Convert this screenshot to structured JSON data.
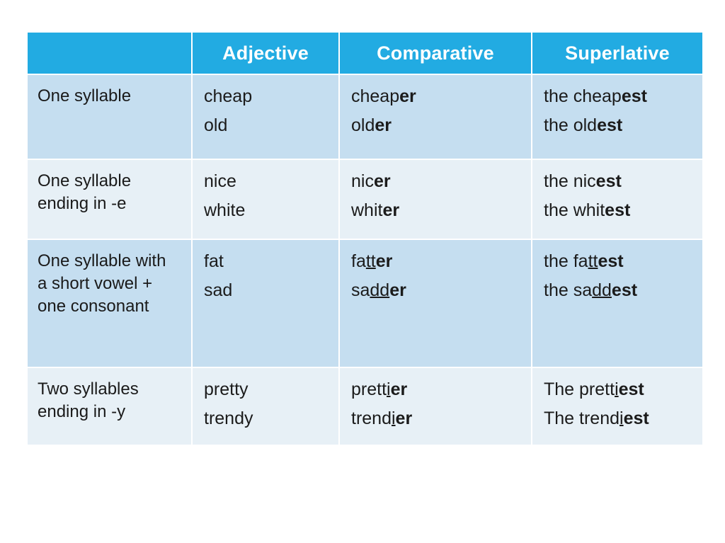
{
  "table": {
    "columns": [
      {
        "key": "rule",
        "label": ""
      },
      {
        "key": "adjective",
        "label": "Adjective"
      },
      {
        "key": "comparative",
        "label": "Comparative"
      },
      {
        "key": "superlative",
        "label": "Superlative"
      }
    ],
    "colors": {
      "header_background": "#22ABE2",
      "header_text": "#FFFFFF",
      "row_shade_dark": "#C5DEF0",
      "row_shade_light": "#E7F0F6",
      "body_text": "#1B1B1B",
      "page_background": "#FFFFFF"
    },
    "rows": [
      {
        "rule": "One syllable",
        "adjectives": [
          "cheap",
          "old"
        ],
        "comparatives": [
          {
            "stem": "cheap",
            "double": "",
            "suffix": "er"
          },
          {
            "stem": "old",
            "double": "",
            "suffix": "er"
          }
        ],
        "superlatives": [
          {
            "article": "the ",
            "stem": "cheap",
            "double": "",
            "suffix": "est"
          },
          {
            "article": "the ",
            "stem": "old",
            "double": "",
            "suffix": "est"
          }
        ]
      },
      {
        "rule": "One syllable ending in -e",
        "adjectives": [
          "nice",
          "white"
        ],
        "comparatives": [
          {
            "stem": "nic",
            "double": "",
            "suffix": "er"
          },
          {
            "stem": "whit",
            "double": "",
            "suffix": "er"
          }
        ],
        "superlatives": [
          {
            "article": "the ",
            "stem": "nic",
            "double": "",
            "suffix": "est"
          },
          {
            "article": "the ",
            "stem": "whit",
            "double": "",
            "suffix": "est"
          }
        ]
      },
      {
        "rule": "One syllable with a short vowel + one consonant",
        "adjectives": [
          "fat",
          "sad"
        ],
        "comparatives": [
          {
            "stem": "fa",
            "double": "tt",
            "suffix": "er"
          },
          {
            "stem": "sa",
            "double": "dd",
            "suffix": "er"
          }
        ],
        "superlatives": [
          {
            "article": "the ",
            "stem": "fa",
            "double": "tt",
            "suffix": "est"
          },
          {
            "article": "the ",
            "stem": "sa",
            "double": "dd",
            "suffix": "est"
          }
        ]
      },
      {
        "rule": "Two syllables ending in -y",
        "adjectives": [
          "pretty",
          "trendy"
        ],
        "comparatives": [
          {
            "stem": "prett",
            "double": "i",
            "suffix": "er"
          },
          {
            "stem": "trend",
            "double": "i",
            "suffix": "er"
          }
        ],
        "superlatives": [
          {
            "article": "The ",
            "stem": "prett",
            "double": "i",
            "suffix": "est"
          },
          {
            "article": "The ",
            "stem": "trend",
            "double": "i",
            "suffix": "est"
          }
        ]
      }
    ]
  }
}
